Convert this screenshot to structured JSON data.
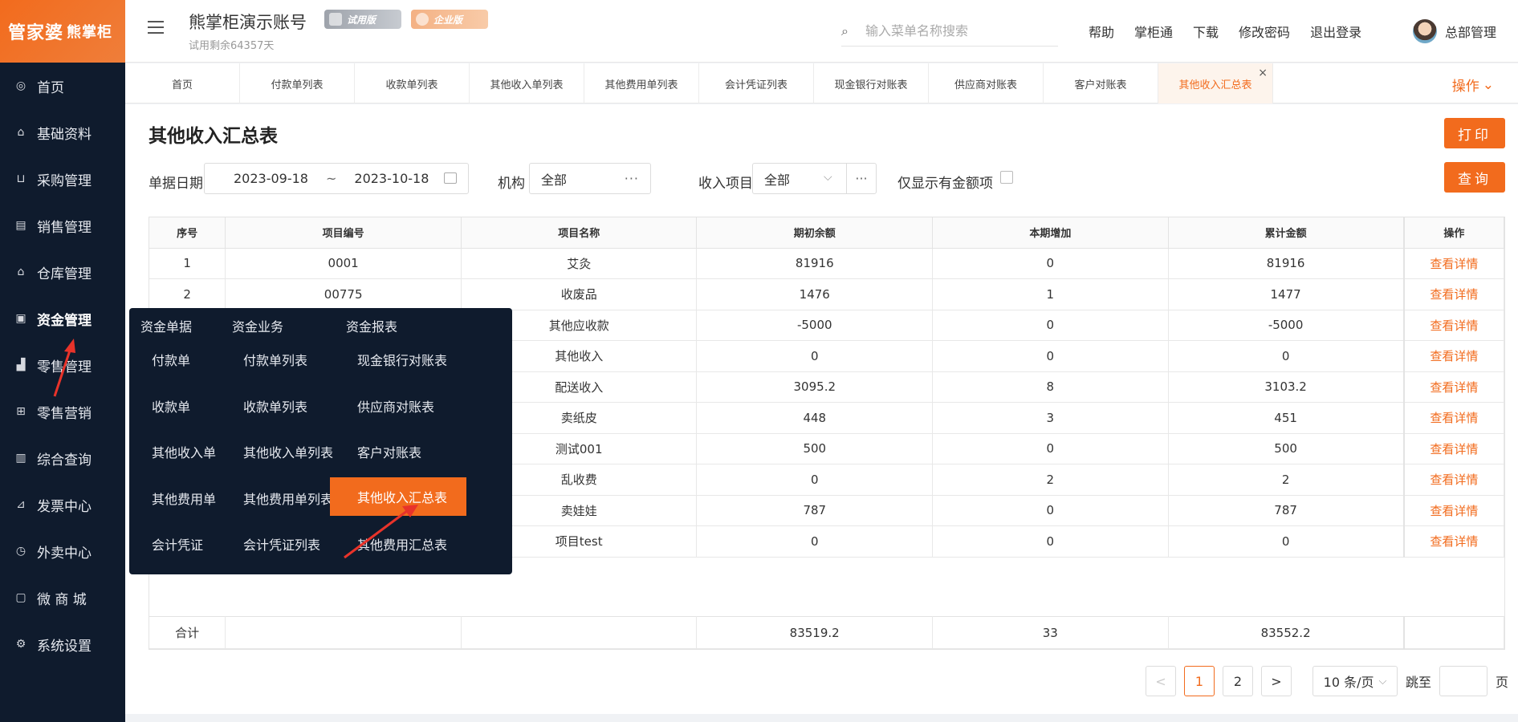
{
  "logo": {
    "brand": "管家婆",
    "sub": "熊掌柜"
  },
  "sidebar": {
    "items": [
      {
        "label": "首页",
        "icon": "globe-icon"
      },
      {
        "label": "基础资料",
        "icon": "home-icon"
      },
      {
        "label": "采购管理",
        "icon": "cart-icon"
      },
      {
        "label": "销售管理",
        "icon": "calendar-icon"
      },
      {
        "label": "仓库管理",
        "icon": "warehouse-icon"
      },
      {
        "label": "资金管理",
        "icon": "money-icon"
      },
      {
        "label": "零售管理",
        "icon": "chart-icon"
      },
      {
        "label": "零售营销",
        "icon": "gift-icon"
      },
      {
        "label": "综合查询",
        "icon": "bar-chart-icon"
      },
      {
        "label": "发票中心",
        "icon": "trend-icon"
      },
      {
        "label": "外卖中心",
        "icon": "delivery-icon"
      },
      {
        "label": "微 商 城",
        "icon": "shop-icon"
      },
      {
        "label": "系统设置",
        "icon": "gear-icon"
      }
    ],
    "active_index": 5
  },
  "header": {
    "account_title": "熊掌柜演示账号",
    "account_sub": "试用剩余64357天",
    "badge_trial": "试用版",
    "badge_enterprise": "企业版",
    "search_placeholder": "输入菜单名称搜索",
    "links": [
      "帮助",
      "掌柜通",
      "下载",
      "修改密码",
      "退出登录"
    ],
    "user_name": "总部管理"
  },
  "tabs": {
    "items": [
      "首页",
      "付款单列表",
      "收款单列表",
      "其他收入单列表",
      "其他费用单列表",
      "会计凭证列表",
      "现金银行对账表",
      "供应商对账表",
      "客户对账表",
      "其他收入汇总表"
    ],
    "active_index": 9,
    "close_glyph": "×",
    "ops_label": "操作"
  },
  "page": {
    "title": "其他收入汇总表",
    "print_label": "打印",
    "query_label": "查询",
    "filters": {
      "date_label": "单据日期",
      "date_from": "2023-09-18",
      "date_sep": "~",
      "date_to": "2023-10-18",
      "org_label": "机构",
      "org_value": "全部",
      "income_label": "收入项目",
      "income_value": "全部",
      "only_amount_label": "仅显示有金额项"
    }
  },
  "table": {
    "headers": [
      "序号",
      "项目编号",
      "项目名称",
      "期初余额",
      "本期增加",
      "累计金额",
      "操作"
    ],
    "rows": [
      [
        "1",
        "0001",
        "艾灸",
        "81916",
        "0",
        "81916",
        "查看详情"
      ],
      [
        "2",
        "00775",
        "收废品",
        "1476",
        "1",
        "1477",
        "查看详情"
      ],
      [
        "",
        "",
        "其他应收款",
        "-5000",
        "0",
        "-5000",
        "查看详情"
      ],
      [
        "",
        "",
        "其他收入",
        "0",
        "0",
        "0",
        "查看详情"
      ],
      [
        "",
        "",
        "配送收入",
        "3095.2",
        "8",
        "3103.2",
        "查看详情"
      ],
      [
        "",
        "",
        "卖纸皮",
        "448",
        "3",
        "451",
        "查看详情"
      ],
      [
        "",
        "",
        "测试001",
        "500",
        "0",
        "500",
        "查看详情"
      ],
      [
        "",
        "",
        "乱收费",
        "0",
        "2",
        "2",
        "查看详情"
      ],
      [
        "",
        "",
        "卖娃娃",
        "787",
        "0",
        "787",
        "查看详情"
      ],
      [
        "",
        "",
        "项目test",
        "0",
        "0",
        "0",
        "查看详情"
      ]
    ],
    "total": {
      "label": "合计",
      "opening": "83519.2",
      "increase": "33",
      "cumulative": "83552.2"
    }
  },
  "pagination": {
    "prev": "<",
    "pages": [
      "1",
      "2"
    ],
    "current": "1",
    "next": ">",
    "page_size": "10 条/页",
    "jump_label": "跳至",
    "page_unit": "页"
  },
  "megamenu": {
    "headers": [
      "资金单据",
      "资金业务",
      "资金报表"
    ],
    "col1": [
      "付款单",
      "收款单",
      "其他收入单",
      "其他费用单",
      "会计凭证"
    ],
    "col2": [
      "付款单列表",
      "收款单列表",
      "其他收入单列表",
      "其他费用单列表",
      "会计凭证列表"
    ],
    "col3": [
      "现金银行对账表",
      "供应商对账表",
      "客户对账表",
      "其他收入汇总表",
      "其他费用汇总表"
    ],
    "active_col3_index": 3
  },
  "colors": {
    "accent": "#f26b1d",
    "sidebar_bg": "#0f1b2d"
  }
}
